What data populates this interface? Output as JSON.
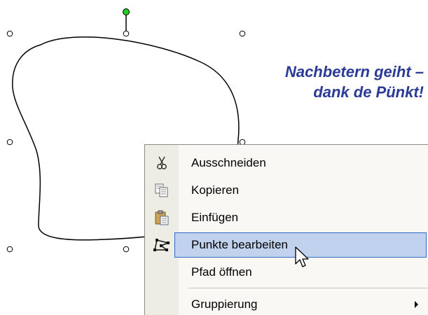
{
  "caption": {
    "line1": "Nachbetern geiht –",
    "line2": "dank de Pünkt!",
    "color": "#2b3a96"
  },
  "shape": {
    "rotation_handle_color": "#22cc22",
    "outline_color": "#000000"
  },
  "context_menu": {
    "items": [
      {
        "label": "Ausschneiden",
        "icon": "scissors-icon"
      },
      {
        "label": "Kopieren",
        "icon": "copy-icon"
      },
      {
        "label": "Einfügen",
        "icon": "paste-icon"
      },
      {
        "label": "Punkte bearbeiten",
        "icon": "edit-points-icon",
        "highlighted": true
      },
      {
        "label": "Pfad öffnen"
      },
      {
        "label": "Gruppierung",
        "has_submenu": true
      }
    ],
    "highlight_color": "#c1d2ee",
    "highlight_border_color": "#316ac5"
  }
}
